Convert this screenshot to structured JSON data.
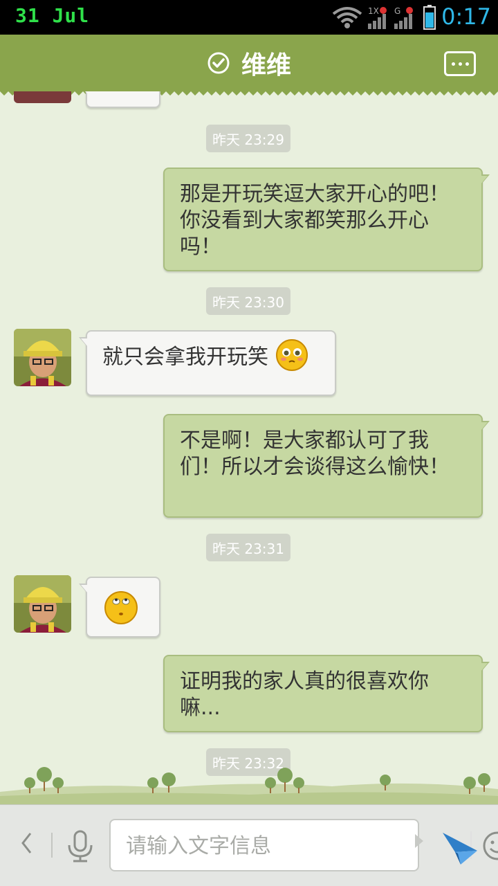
{
  "status_bar": {
    "date": "31 Jul",
    "time": "0:17",
    "network_1_label": "1X",
    "network_2_label": "G",
    "icons": [
      "wifi-icon",
      "signal-icon",
      "battery-icon"
    ],
    "colors": {
      "date": "#2fe04a",
      "time": "#2fb8e8"
    }
  },
  "header": {
    "title": "维维",
    "status_icon": "check-circle-icon",
    "menu_icon": "more-dots-icon",
    "color": "#8aa54c"
  },
  "messages": [
    {
      "type": "time",
      "text": "昨天 23:29"
    },
    {
      "type": "out",
      "text": "那是开玩笑逗大家开心的吧！你没看到大家都笑那么开心吗！"
    },
    {
      "type": "time",
      "text": "昨天 23:30"
    },
    {
      "type": "in",
      "text": "就只会拿我开玩笑",
      "emoji": "pleading-face-icon"
    },
    {
      "type": "out",
      "text": "不是啊！是大家都认可了我们！所以才会谈得这么愉快！"
    },
    {
      "type": "time",
      "text": "昨天 23:31"
    },
    {
      "type": "in",
      "text": "",
      "emoji": "eye-roll-face-icon"
    },
    {
      "type": "out",
      "text": "证明我的家人真的很喜欢你嘛..."
    },
    {
      "type": "time",
      "text": "昨天 23:32"
    }
  ],
  "input_bar": {
    "placeholder": "请输入文字信息",
    "icons": [
      "back-arrow-icon",
      "microphone-icon",
      "smiley-icon",
      "send-icon"
    ]
  }
}
